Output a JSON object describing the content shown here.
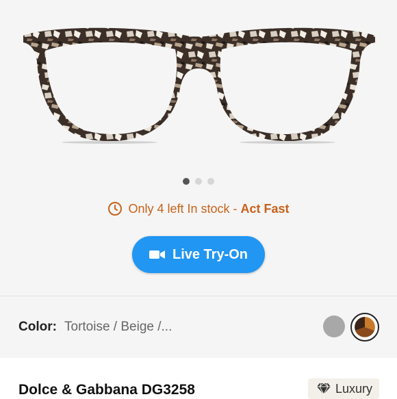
{
  "carousel": {
    "total": 3,
    "active": 1
  },
  "stock": {
    "prefix": "Only 4 left In stock - ",
    "emphasis": "Act Fast"
  },
  "tryon": {
    "label": "Live Try-On"
  },
  "color": {
    "label": "Color:",
    "value": "Tortoise / Beige /..."
  },
  "product": {
    "name": "Dolce & Gabbana DG3258",
    "badge": "Luxury"
  },
  "colors": {
    "accent": "#2196f3",
    "stock_text": "#c8621a"
  },
  "icons": [
    "clock-icon",
    "video-camera-icon",
    "diamond-icon"
  ]
}
